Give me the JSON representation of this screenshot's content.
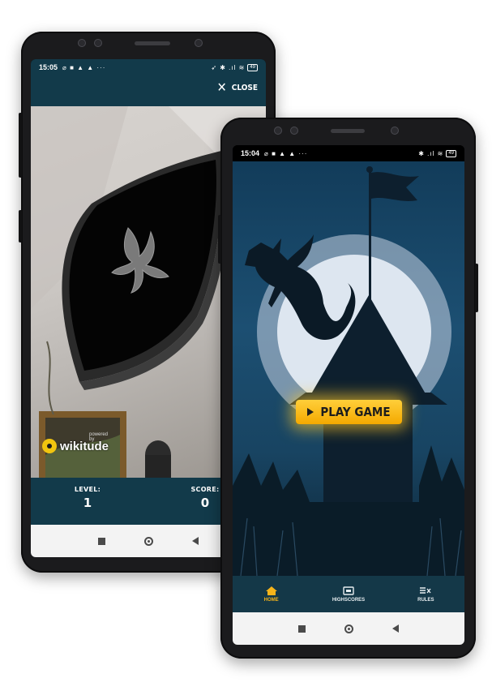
{
  "left_phone": {
    "status": {
      "time": "15:05",
      "icons_left": "⌀ ■ ▲ ▲ ···",
      "icons_right": "➶ ✱ .ıl ≋",
      "battery": "49"
    },
    "header": {
      "close_label": "CLOSE"
    },
    "watermark": {
      "powered": "powered by",
      "brand": "wikitude"
    },
    "footer": {
      "level_label": "LEVEL:",
      "level_value": "1",
      "score_label": "SCORE:",
      "score_value": "0"
    }
  },
  "right_phone": {
    "status": {
      "time": "15:04",
      "icons_left": "⌀ ■ ▲ ▲ ···",
      "icons_right": "✱ .ıl ≋",
      "battery": "49"
    },
    "play_button_label": "PLAY GAME",
    "tabs": [
      {
        "label": "HOME",
        "icon": "home-icon",
        "active": true
      },
      {
        "label": "HIGHSCORES",
        "icon": "trophy-icon",
        "active": false
      },
      {
        "label": "RULES",
        "icon": "rules-icon",
        "active": false
      }
    ]
  },
  "colors": {
    "header_bg": "#123a4a",
    "accent": "#f6b41a",
    "play_button": "#ffc21a"
  }
}
